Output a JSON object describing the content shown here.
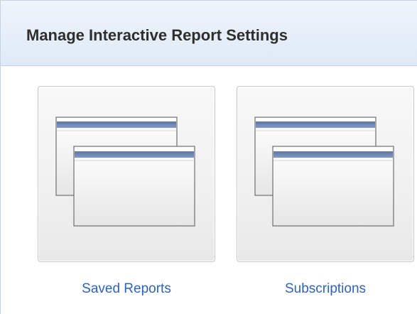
{
  "panel": {
    "title": "Manage Interactive Report Settings"
  },
  "tiles": [
    {
      "label": "Saved Reports",
      "icon": "report-windows-icon"
    },
    {
      "label": "Subscriptions",
      "icon": "report-windows-icon"
    }
  ],
  "colors": {
    "header_background": "#dfeaf7",
    "link_text": "#2f63b8",
    "title_text": "#2e2e2e",
    "window_bar": "#6f86b2"
  }
}
